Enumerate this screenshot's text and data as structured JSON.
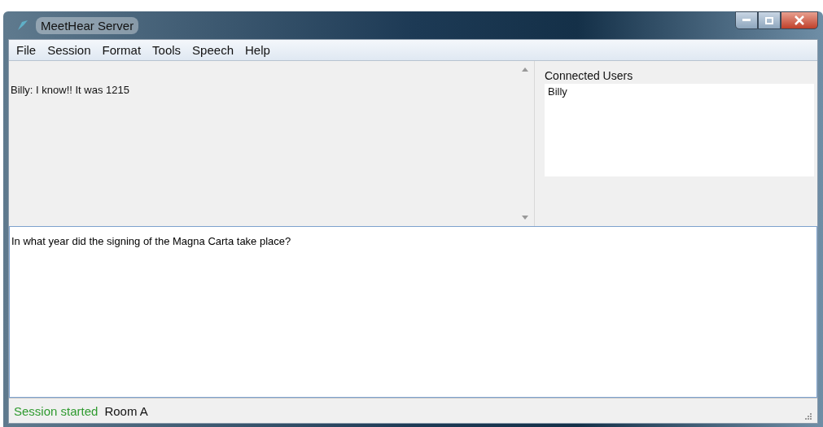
{
  "window": {
    "title": "MeetHear Server"
  },
  "menu": [
    "File",
    "Session",
    "Format",
    "Tools",
    "Speech",
    "Help"
  ],
  "chat_log": [
    "Billy: I know!!  It was 1215"
  ],
  "connected_users": {
    "label": "Connected Users",
    "users": [
      "Billy"
    ]
  },
  "message_input": {
    "value": "In what year did the signing of the Magna Carta take place?"
  },
  "status_bar": [
    {
      "text": "Session started",
      "color": "#2f9a2f"
    },
    {
      "text": "Room A",
      "color": "#111111"
    }
  ]
}
